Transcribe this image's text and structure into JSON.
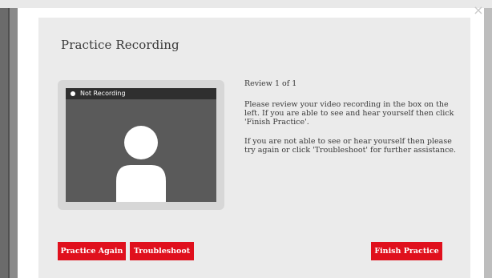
{
  "dialog": {
    "title": "Practice Recording",
    "close_glyph": "×",
    "recording_status": "Not Recording",
    "review_count": "Review 1 of 1",
    "instructions_1": "Please review your video recording in the box on the left. If you are able to see and hear yourself then click 'Finish Practice'.",
    "instructions_2": "If you are not able to see or hear yourself then please try again or click 'Troubleshoot' for further assistance."
  },
  "buttons": {
    "practice_again": "Practice Again",
    "troubleshoot": "Troubleshoot",
    "finish_practice": "Finish Practice"
  },
  "colors": {
    "accent": "#e0101d",
    "overlay": "#505050",
    "panel": "#ebebeb",
    "video_background": "#5a5a5a"
  },
  "icons": [
    "close-icon",
    "recording-dot-icon",
    "user-avatar-icon"
  ]
}
